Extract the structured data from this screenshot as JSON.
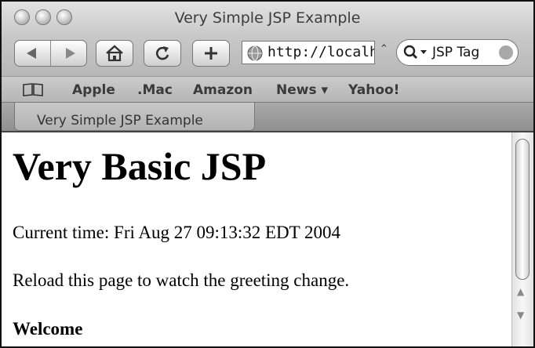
{
  "window": {
    "title": "Very Simple JSP Example"
  },
  "toolbar": {
    "back_icon": "back-arrow-icon",
    "forward_icon": "forward-arrow-icon",
    "home_icon": "home-icon",
    "reload_icon": "reload-icon",
    "add_icon": "plus-icon",
    "url": "http://localhost",
    "search_value": "JSP Tag"
  },
  "bookmarks": {
    "items": [
      {
        "label": "Apple"
      },
      {
        "label": ".Mac"
      },
      {
        "label": "Amazon"
      },
      {
        "label": "News ▾"
      },
      {
        "label": "Yahoo!"
      }
    ]
  },
  "tabs": [
    {
      "label": "Very Simple JSP Example"
    }
  ],
  "content": {
    "heading": "Very Basic JSP",
    "time_line": "Current time: Fri Aug 27 09:13:32 EDT 2004",
    "instruction": "Reload this page to watch the greeting change.",
    "greeting": "Welcome"
  }
}
